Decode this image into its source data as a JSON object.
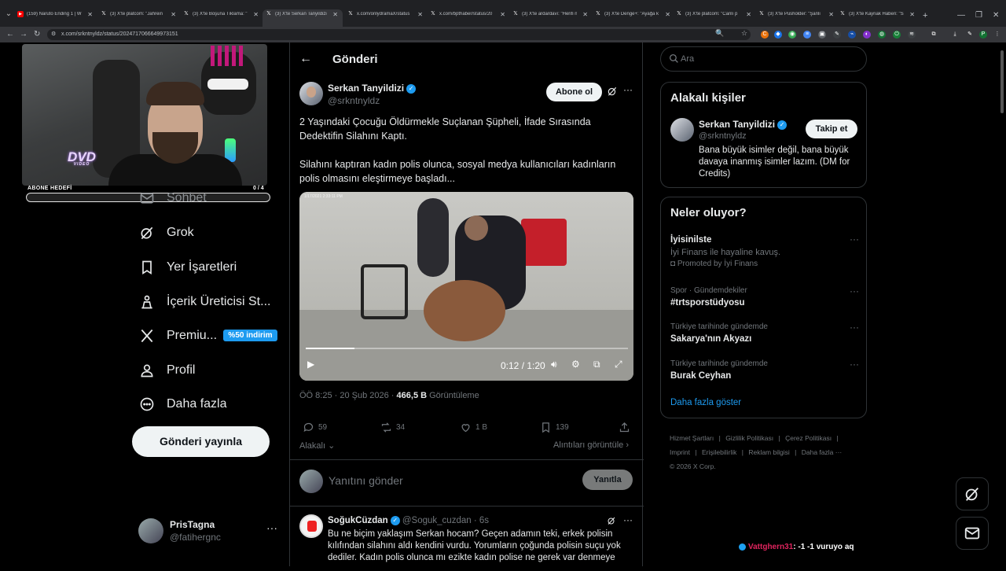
{
  "browser": {
    "tabs": [
      {
        "title": "(159) Naruto Ending 1 | W",
        "favicon": "youtube-icon"
      },
      {
        "title": "(3) X'te platcom: \"Jahrein",
        "favicon": "x-icon"
      },
      {
        "title": "(3) X'te Boşuna Tıklama: \"",
        "favicon": "x-icon"
      },
      {
        "title": "(3) X'te Serkan Tanyildizi:",
        "favicon": "x-icon",
        "active": true
      },
      {
        "title": "x.com/onlydramaX/status",
        "favicon": "x-icon"
      },
      {
        "title": "x.com/bpthaber/status/20",
        "favicon": "x-icon"
      },
      {
        "title": "(3) X'te ardardavı: \"Herifi n",
        "favicon": "x-icon"
      },
      {
        "title": "(3) X'te Denge+: \"Ayağa k",
        "favicon": "x-icon"
      },
      {
        "title": "(3) X'te platcom: \"Canlı p",
        "favicon": "x-icon"
      },
      {
        "title": "(3) X'te Pusholder: \"Şanlı",
        "favicon": "x-icon"
      },
      {
        "title": "(3) X'te Kaynak Haberi: \"Sa",
        "favicon": "x-icon"
      }
    ],
    "url": "x.com/srkntnyldz/status/2024717066649973151"
  },
  "stream_overlay": {
    "goal_label": "ABONE HEDEFİ",
    "goal_count": "0 / 4",
    "goal_progress": 0.0,
    "logo_text": "DVD",
    "logo_sub": "VIDEO",
    "chat": {
      "user": "Vattghern31",
      "message": ": -1 -1 vuruyo aq"
    }
  },
  "sidebar": {
    "items": [
      {
        "label": "Sohbet",
        "icon": "mail-icon"
      },
      {
        "label": "Grok",
        "icon": "grok-icon"
      },
      {
        "label": "Yer İşaretleri",
        "icon": "bookmark-icon"
      },
      {
        "label": "İçerik Üreticisi St...",
        "icon": "creator-studio-icon"
      },
      {
        "label": "Premiu...",
        "icon": "x-logo-icon"
      },
      {
        "label": "Profil",
        "icon": "person-icon"
      },
      {
        "label": "Daha fazla",
        "icon": "more-circle-icon"
      }
    ],
    "premium_badge": "%50 indirim",
    "post_button": "Gönderi yayınla",
    "account": {
      "name": "PrisTagna",
      "handle": "@fatihergnc"
    }
  },
  "main": {
    "title": "Gönderi",
    "tweet": {
      "author_name": "Serkan Tanyildizi",
      "author_handle": "@srkntnyldz",
      "subscribe_label": "Abone ol",
      "text_1": "2 Yaşındaki Çocuğu Öldürmekle Suçlanan Şüpheli, İfade Sırasında Dedektifin Silahını Kaptı.",
      "text_2": "Silahını kaptıran kadın polis olunca, sosyal medya kullanıcıları kadınların polis olmasını eleştirmeye başladı...",
      "video": {
        "timestamp": "1/17/2021 2:33:11 PM",
        "time": "0:12 / 1:20",
        "progress": 0.15
      },
      "time": "ÖÖ 8:25 · 20 Şub 2026 ·",
      "views": "466,5 B",
      "views_label": "Görüntüleme",
      "stats": {
        "replies": "59",
        "reposts": "34",
        "likes": "1 B",
        "bookmarks": "139"
      },
      "relevance_label": "Alakalı",
      "quotes_label": "Alıntıları görüntüle"
    },
    "reply_placeholder": "Yanıtını gönder",
    "reply_button": "Yanıtla",
    "reply_tweet": {
      "author_name": "SoğukCüzdan",
      "author_handle": "@Soguk_cuzdan",
      "time": "· 6s",
      "text": "Bu ne biçim yaklaşım Serkan hocam? Geçen adamın teki, erkek polisin kılıfından silahını aldı kendini vurdu. Yorumların çoğunda polisin suçu yok dediler. Kadın polis olunca mı ezikte kadın polise ne gerek var denmeye"
    }
  },
  "right": {
    "search_placeholder": "Ara",
    "related": {
      "title": "Alakalı kişiler",
      "name": "Serkan Tanyildizi",
      "handle": "@srkntnyldz",
      "bio": "Bana büyük isimler değil, bana büyük davaya inanmış isimler lazım. (DM for Credits)",
      "follow_label": "Takip et"
    },
    "trends": {
      "title": "Neler oluyor?",
      "items": [
        {
          "name": "İyisinilste",
          "sub": "İyi Finans ile hayaline kavuş.",
          "promo": "Promoted by İyi Finans"
        },
        {
          "meta": "Spor · Gündemdekiler",
          "name": "#trtsporstüdyosu"
        },
        {
          "meta": "Türkiye tarihinde gündemde",
          "name": "Sakarya'nın Akyazı"
        },
        {
          "meta": "Türkiye tarihinde gündemde",
          "name": "Burak Ceyhan"
        }
      ],
      "show_more": "Daha fazla göster"
    },
    "footer": {
      "links": [
        "Hizmet Şartları",
        "|",
        "Gizlilik Politikası",
        "|",
        "Çerez Politikası",
        "|",
        "Imprint",
        "|",
        "Erişilebilirlik",
        "|",
        "Reklam bilgisi",
        "|",
        "Daha fazla ···"
      ],
      "copyright": "© 2026 X Corp."
    }
  }
}
